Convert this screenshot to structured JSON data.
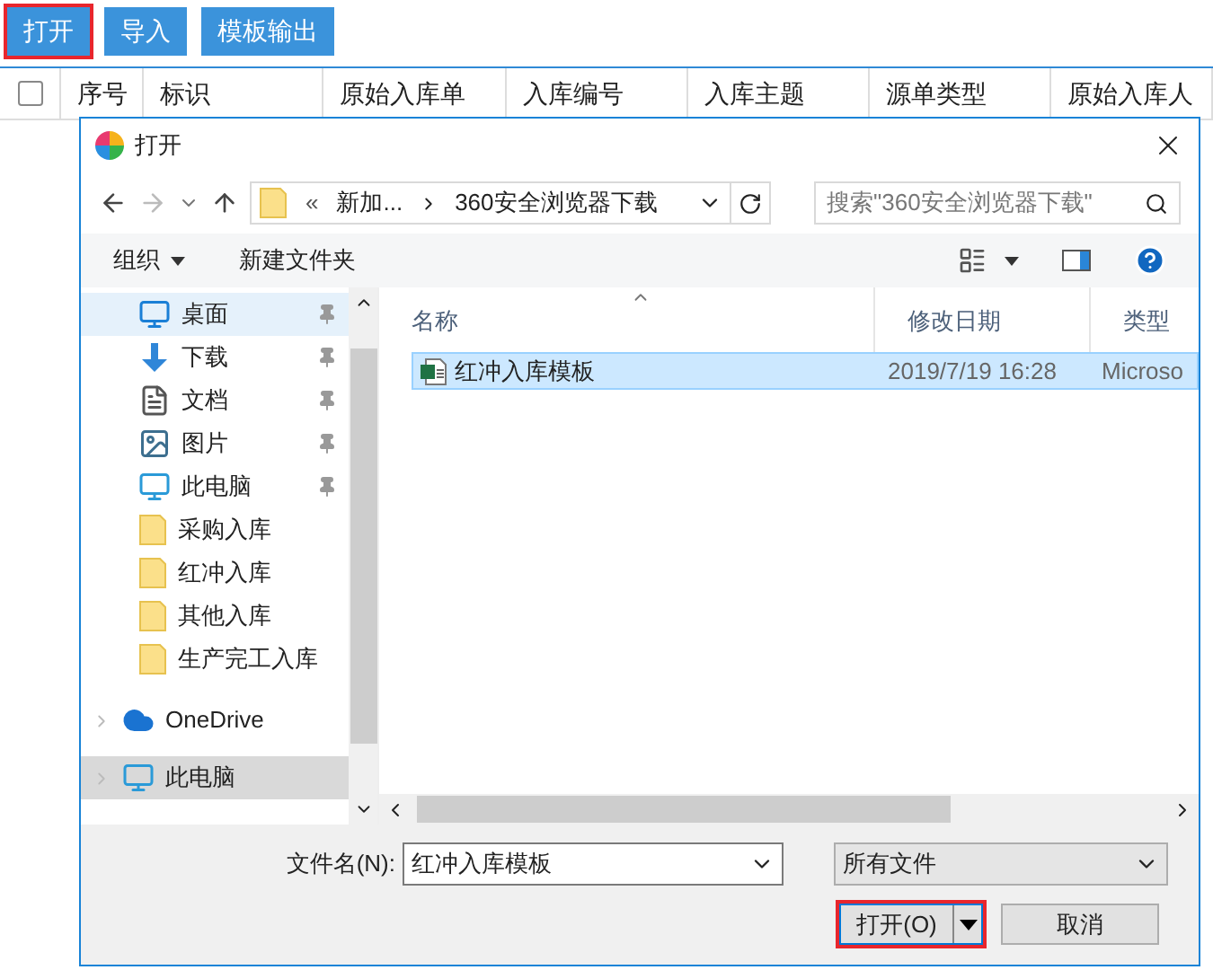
{
  "toolbar": {
    "buttons": [
      {
        "label": "打开",
        "highlighted": true
      },
      {
        "label": "导入",
        "highlighted": false
      },
      {
        "label": "模板输出",
        "highlighted": false
      }
    ]
  },
  "table": {
    "select_all_checked": false,
    "columns": [
      "序号",
      "标识",
      "原始入库单",
      "入库编号",
      "入库主题",
      "源单类型",
      "原始入库人"
    ]
  },
  "dialog": {
    "title": "打开",
    "address": {
      "overflow": "«",
      "segments": [
        "新加...",
        "360安全浏览器下载"
      ]
    },
    "search": {
      "placeholder": "搜索\"360安全浏览器下载\""
    },
    "commands": [
      {
        "label": "组织",
        "dropdown": true
      },
      {
        "label": "新建文件夹",
        "dropdown": false
      }
    ],
    "quick_access": [
      {
        "label": "桌面",
        "kind": "desktop",
        "pinned": true,
        "selected": true
      },
      {
        "label": "下载",
        "kind": "download",
        "pinned": true,
        "selected": false
      },
      {
        "label": "文档",
        "kind": "document",
        "pinned": true,
        "selected": false
      },
      {
        "label": "图片",
        "kind": "pictures",
        "pinned": true,
        "selected": false
      },
      {
        "label": "此电脑",
        "kind": "computer",
        "pinned": true,
        "selected": false
      },
      {
        "label": "采购入库",
        "kind": "folder",
        "pinned": false,
        "selected": false
      },
      {
        "label": "红冲入库",
        "kind": "folder",
        "pinned": false,
        "selected": false
      },
      {
        "label": "其他入库",
        "kind": "folder",
        "pinned": false,
        "selected": false
      },
      {
        "label": "生产完工入库",
        "kind": "folder",
        "pinned": false,
        "selected": false
      }
    ],
    "roots": [
      {
        "label": "OneDrive",
        "kind": "cloud",
        "selected": false
      },
      {
        "label": "此电脑",
        "kind": "computer",
        "selected": true
      }
    ],
    "file_columns": [
      "名称",
      "修改日期",
      "类型"
    ],
    "files": [
      {
        "name": "红冲入库模板",
        "modified": "2019/7/19 16:28",
        "type": "Microso",
        "selected": true
      }
    ],
    "filename_label": "文件名(N):",
    "filename": "红冲入库模板",
    "filter": "所有文件",
    "buttons": [
      {
        "label": "打开(O)",
        "kind": "split",
        "highlighted": true
      },
      {
        "label": "取消",
        "kind": "plain",
        "highlighted": false
      }
    ]
  }
}
